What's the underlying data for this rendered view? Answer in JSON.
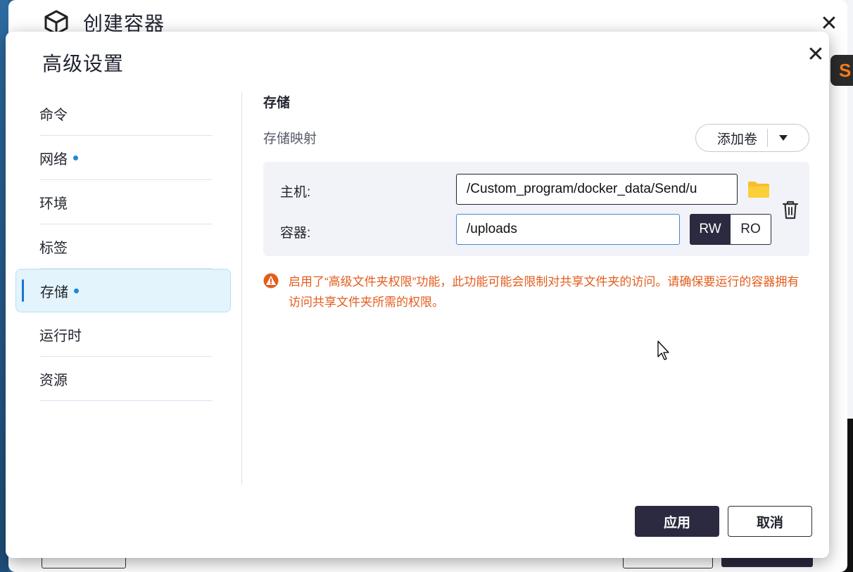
{
  "back_window": {
    "title": "创建容器",
    "icon": "cube-icon"
  },
  "badge": {
    "text": "S"
  },
  "dialog": {
    "title": "高级设置",
    "close_icon": "close-icon"
  },
  "sidebar": {
    "items": [
      {
        "label": "命令",
        "dot": false,
        "active": false
      },
      {
        "label": "网络",
        "dot": true,
        "active": false
      },
      {
        "label": "环境",
        "dot": false,
        "active": false
      },
      {
        "label": "标签",
        "dot": false,
        "active": false
      },
      {
        "label": "存储",
        "dot": true,
        "active": true
      },
      {
        "label": "运行时",
        "dot": false,
        "active": false
      },
      {
        "label": "资源",
        "dot": false,
        "active": false
      }
    ]
  },
  "storage": {
    "section_title": "存储",
    "mapping_label": "存储映射",
    "add_volume_label": "添加卷",
    "host_label": "主机:",
    "host_value": "/Custom_program/docker_data/Send/u",
    "container_label": "容器:",
    "container_value": "/uploads",
    "rw_label": "RW",
    "ro_label": "RO",
    "mode_selected": "RW",
    "warning": "启用了“高级文件夹权限”功能，此功能可能会限制对共享文件夹的访问。请确保要运行的容器拥有访问共享文件夹所需的权限。"
  },
  "footer": {
    "apply_label": "应用",
    "cancel_label": "取消"
  },
  "colors": {
    "primary": "#2b2a40",
    "accent_blue": "#1e88d8",
    "warning": "#e35d1d",
    "folder": "#f6c02c",
    "active_bg": "#e4f4fc"
  }
}
